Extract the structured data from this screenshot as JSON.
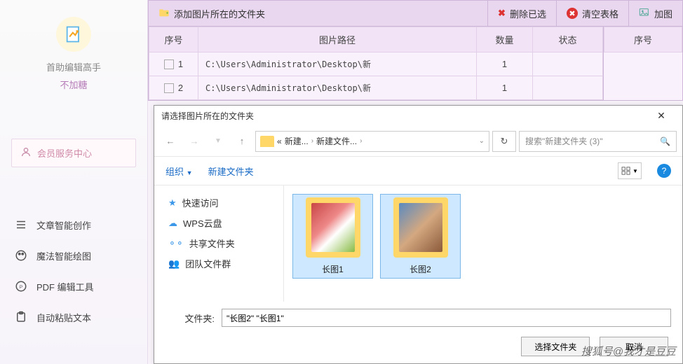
{
  "sidebar": {
    "app_name": "首助编辑高手",
    "app_sub": "不加糖",
    "member_link": "会员服务中心",
    "nav": [
      {
        "label": "文章智能创作"
      },
      {
        "label": "魔法智能绘图"
      },
      {
        "label": "PDF 编辑工具"
      },
      {
        "label": "自动粘贴文本"
      }
    ]
  },
  "toolbar": {
    "add_folder": "添加图片所在的文件夹",
    "delete_selected": "删除已选",
    "clear_table": "清空表格",
    "add_image": "加图"
  },
  "table": {
    "headers": {
      "seq": "序号",
      "path": "图片路径",
      "qty": "数量",
      "status": "状态"
    },
    "side_header": "序号",
    "rows": [
      {
        "seq": "1",
        "path": "C:\\Users\\Administrator\\Desktop\\新",
        "qty": "1",
        "status": ""
      },
      {
        "seq": "2",
        "path": "C:\\Users\\Administrator\\Desktop\\新",
        "qty": "1",
        "status": ""
      }
    ]
  },
  "dialog": {
    "title": "请选择图片所在的文件夹",
    "breadcrumb": {
      "prefix": "«",
      "seg1": "新建...",
      "seg2": "新建文件..."
    },
    "search_placeholder": "搜索\"新建文件夹 (3)\"",
    "toolbar": {
      "organize": "组织",
      "new_folder": "新建文件夹"
    },
    "tree": [
      {
        "label": "快速访问",
        "icon": "star",
        "color": "#3b97e8"
      },
      {
        "label": "WPS云盘",
        "icon": "cloud",
        "color": "#3b97e8"
      },
      {
        "label": "共享文件夹",
        "icon": "share",
        "color": "#3b97e8"
      },
      {
        "label": "团队文件群",
        "icon": "team",
        "color": "#3b97e8"
      }
    ],
    "items": [
      {
        "name": "长图1"
      },
      {
        "name": "长图2"
      }
    ],
    "folder_label": "文件夹:",
    "folder_value": "\"长图2\" \"长图1\"",
    "select_btn": "选择文件夹",
    "cancel_btn": "取消"
  },
  "watermark": "搜狐号@我才是豆豆"
}
